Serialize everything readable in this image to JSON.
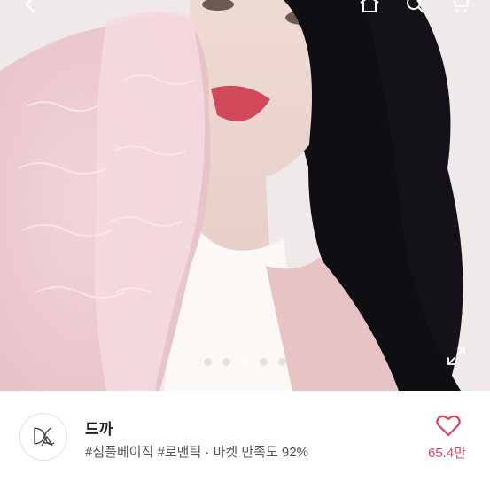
{
  "product_image": {
    "alt": "product-photo",
    "carousel": {
      "total": 5,
      "active_index": 2
    }
  },
  "topbar": {
    "back_icon": "chevron-left-icon",
    "home_icon": "home-icon",
    "search_icon": "search-icon",
    "cart_icon": "cart-icon"
  },
  "shop": {
    "name": "드까",
    "meta": "#심플베이직 #로맨틱 · 마켓 만족도 92%"
  },
  "favorite": {
    "icon": "heart-outline-icon",
    "count": "65.4만",
    "color": "#e0405a"
  }
}
